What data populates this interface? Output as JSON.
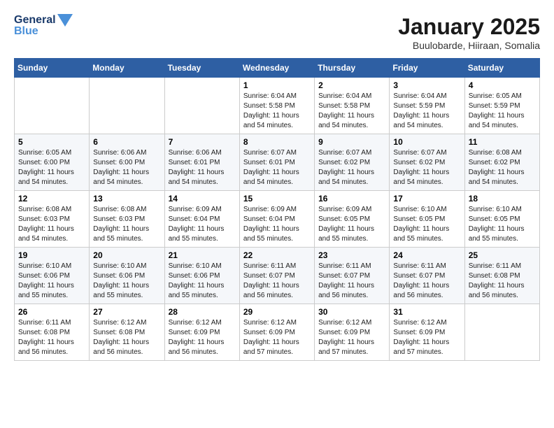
{
  "logo": {
    "line1": "General",
    "line2": "Blue"
  },
  "title": "January 2025",
  "location": "Buulobarde, Hiiraan, Somalia",
  "days_of_week": [
    "Sunday",
    "Monday",
    "Tuesday",
    "Wednesday",
    "Thursday",
    "Friday",
    "Saturday"
  ],
  "weeks": [
    [
      {
        "day": "",
        "info": ""
      },
      {
        "day": "",
        "info": ""
      },
      {
        "day": "",
        "info": ""
      },
      {
        "day": "1",
        "info": "Sunrise: 6:04 AM\nSunset: 5:58 PM\nDaylight: 11 hours\nand 54 minutes."
      },
      {
        "day": "2",
        "info": "Sunrise: 6:04 AM\nSunset: 5:58 PM\nDaylight: 11 hours\nand 54 minutes."
      },
      {
        "day": "3",
        "info": "Sunrise: 6:04 AM\nSunset: 5:59 PM\nDaylight: 11 hours\nand 54 minutes."
      },
      {
        "day": "4",
        "info": "Sunrise: 6:05 AM\nSunset: 5:59 PM\nDaylight: 11 hours\nand 54 minutes."
      }
    ],
    [
      {
        "day": "5",
        "info": "Sunrise: 6:05 AM\nSunset: 6:00 PM\nDaylight: 11 hours\nand 54 minutes."
      },
      {
        "day": "6",
        "info": "Sunrise: 6:06 AM\nSunset: 6:00 PM\nDaylight: 11 hours\nand 54 minutes."
      },
      {
        "day": "7",
        "info": "Sunrise: 6:06 AM\nSunset: 6:01 PM\nDaylight: 11 hours\nand 54 minutes."
      },
      {
        "day": "8",
        "info": "Sunrise: 6:07 AM\nSunset: 6:01 PM\nDaylight: 11 hours\nand 54 minutes."
      },
      {
        "day": "9",
        "info": "Sunrise: 6:07 AM\nSunset: 6:02 PM\nDaylight: 11 hours\nand 54 minutes."
      },
      {
        "day": "10",
        "info": "Sunrise: 6:07 AM\nSunset: 6:02 PM\nDaylight: 11 hours\nand 54 minutes."
      },
      {
        "day": "11",
        "info": "Sunrise: 6:08 AM\nSunset: 6:02 PM\nDaylight: 11 hours\nand 54 minutes."
      }
    ],
    [
      {
        "day": "12",
        "info": "Sunrise: 6:08 AM\nSunset: 6:03 PM\nDaylight: 11 hours\nand 54 minutes."
      },
      {
        "day": "13",
        "info": "Sunrise: 6:08 AM\nSunset: 6:03 PM\nDaylight: 11 hours\nand 55 minutes."
      },
      {
        "day": "14",
        "info": "Sunrise: 6:09 AM\nSunset: 6:04 PM\nDaylight: 11 hours\nand 55 minutes."
      },
      {
        "day": "15",
        "info": "Sunrise: 6:09 AM\nSunset: 6:04 PM\nDaylight: 11 hours\nand 55 minutes."
      },
      {
        "day": "16",
        "info": "Sunrise: 6:09 AM\nSunset: 6:05 PM\nDaylight: 11 hours\nand 55 minutes."
      },
      {
        "day": "17",
        "info": "Sunrise: 6:10 AM\nSunset: 6:05 PM\nDaylight: 11 hours\nand 55 minutes."
      },
      {
        "day": "18",
        "info": "Sunrise: 6:10 AM\nSunset: 6:05 PM\nDaylight: 11 hours\nand 55 minutes."
      }
    ],
    [
      {
        "day": "19",
        "info": "Sunrise: 6:10 AM\nSunset: 6:06 PM\nDaylight: 11 hours\nand 55 minutes."
      },
      {
        "day": "20",
        "info": "Sunrise: 6:10 AM\nSunset: 6:06 PM\nDaylight: 11 hours\nand 55 minutes."
      },
      {
        "day": "21",
        "info": "Sunrise: 6:10 AM\nSunset: 6:06 PM\nDaylight: 11 hours\nand 55 minutes."
      },
      {
        "day": "22",
        "info": "Sunrise: 6:11 AM\nSunset: 6:07 PM\nDaylight: 11 hours\nand 56 minutes."
      },
      {
        "day": "23",
        "info": "Sunrise: 6:11 AM\nSunset: 6:07 PM\nDaylight: 11 hours\nand 56 minutes."
      },
      {
        "day": "24",
        "info": "Sunrise: 6:11 AM\nSunset: 6:07 PM\nDaylight: 11 hours\nand 56 minutes."
      },
      {
        "day": "25",
        "info": "Sunrise: 6:11 AM\nSunset: 6:08 PM\nDaylight: 11 hours\nand 56 minutes."
      }
    ],
    [
      {
        "day": "26",
        "info": "Sunrise: 6:11 AM\nSunset: 6:08 PM\nDaylight: 11 hours\nand 56 minutes."
      },
      {
        "day": "27",
        "info": "Sunrise: 6:12 AM\nSunset: 6:08 PM\nDaylight: 11 hours\nand 56 minutes."
      },
      {
        "day": "28",
        "info": "Sunrise: 6:12 AM\nSunset: 6:09 PM\nDaylight: 11 hours\nand 56 minutes."
      },
      {
        "day": "29",
        "info": "Sunrise: 6:12 AM\nSunset: 6:09 PM\nDaylight: 11 hours\nand 57 minutes."
      },
      {
        "day": "30",
        "info": "Sunrise: 6:12 AM\nSunset: 6:09 PM\nDaylight: 11 hours\nand 57 minutes."
      },
      {
        "day": "31",
        "info": "Sunrise: 6:12 AM\nSunset: 6:09 PM\nDaylight: 11 hours\nand 57 minutes."
      },
      {
        "day": "",
        "info": ""
      }
    ]
  ]
}
